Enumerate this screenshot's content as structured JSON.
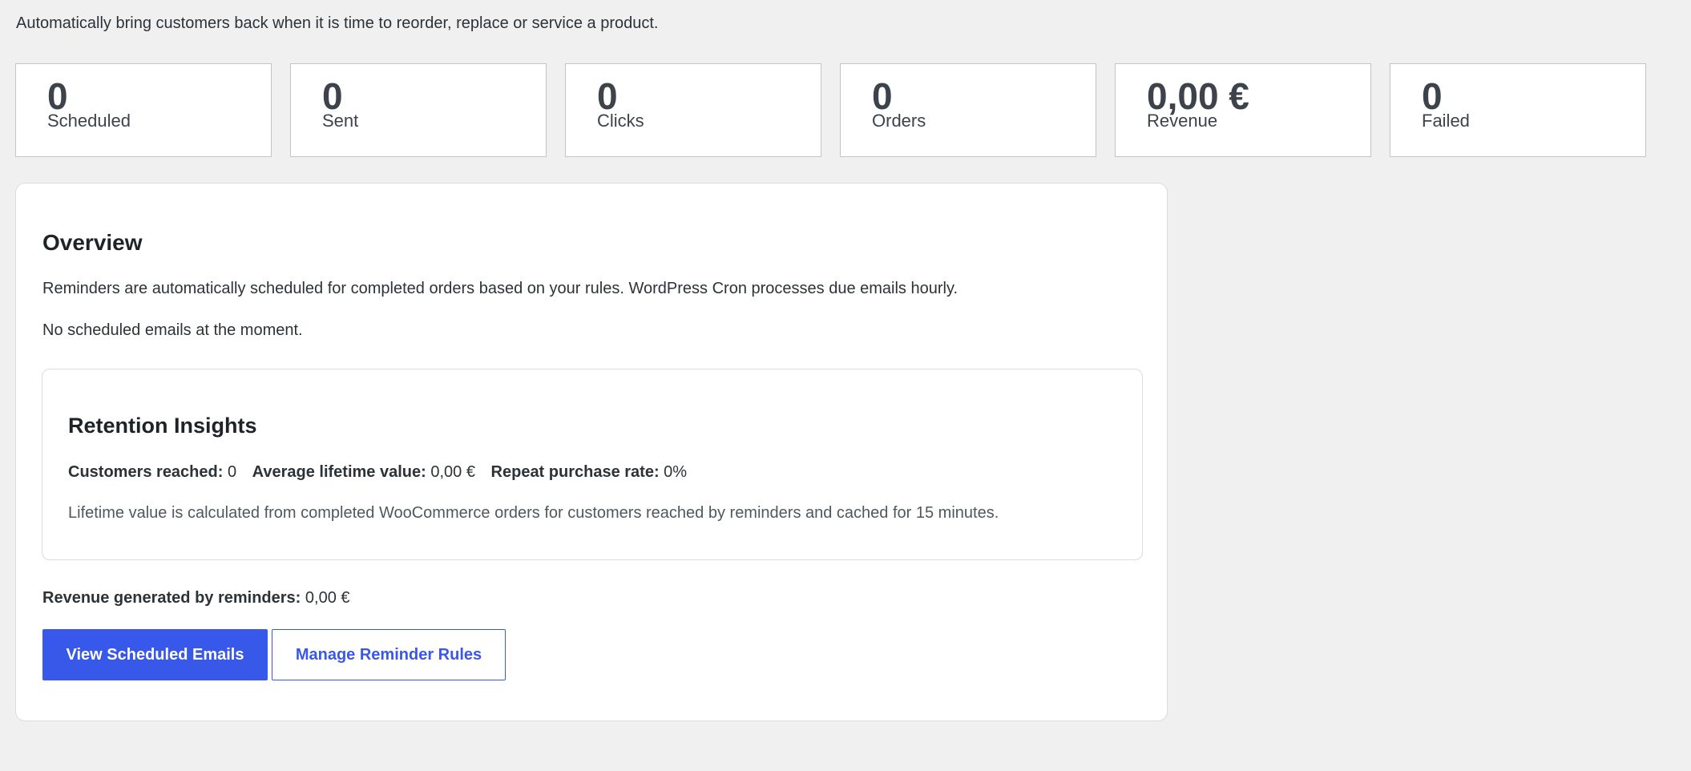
{
  "intro": "Automatically bring customers back when it is time to reorder, replace or service a product.",
  "stats": [
    {
      "value": "0",
      "label": "Scheduled"
    },
    {
      "value": "0",
      "label": "Sent"
    },
    {
      "value": "0",
      "label": "Clicks"
    },
    {
      "value": "0",
      "label": "Orders"
    },
    {
      "value": "0,00 €",
      "label": "Revenue"
    },
    {
      "value": "0",
      "label": "Failed"
    }
  ],
  "overview": {
    "title": "Overview",
    "description": "Reminders are automatically scheduled for completed orders based on your rules. WordPress Cron processes due emails hourly.",
    "empty_message": "No scheduled emails at the moment.",
    "insights": {
      "title": "Retention Insights",
      "customers_reached_label": "Customers reached:",
      "customers_reached_value": "0",
      "avg_lifetime_label": "Average lifetime value:",
      "avg_lifetime_value": "0,00 €",
      "repeat_rate_label": "Repeat purchase rate:",
      "repeat_rate_value": "0%",
      "note": "Lifetime value is calculated from completed WooCommerce orders for customers reached by reminders and cached for 15 minutes."
    },
    "revenue_label": "Revenue generated by reminders:",
    "revenue_value": "0,00 €",
    "buttons": {
      "view_scheduled": "View Scheduled Emails",
      "manage_rules": "Manage Reminder Rules"
    }
  },
  "colors": {
    "accent": "#3858e9",
    "background": "#f0f0f1"
  }
}
